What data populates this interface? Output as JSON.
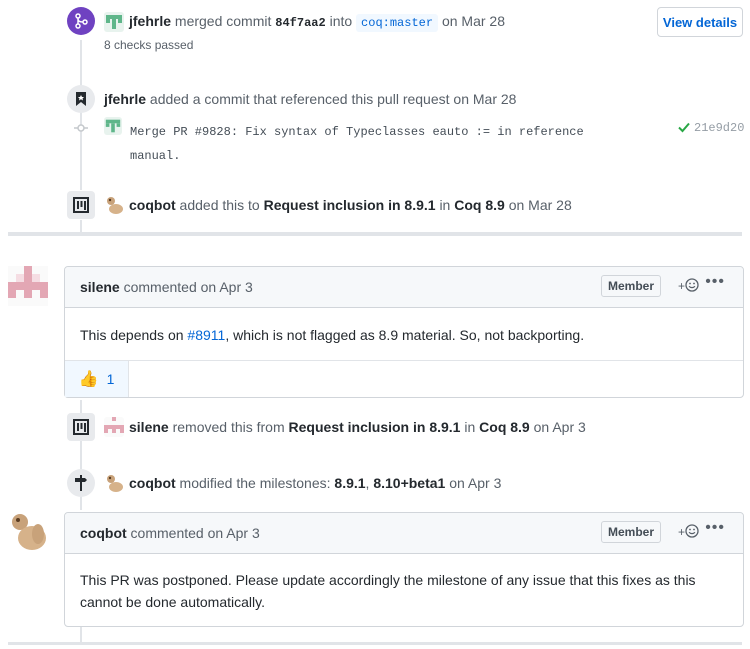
{
  "merge_event": {
    "user": "jfehrle",
    "action": "merged commit",
    "commit": "84f7aa2",
    "into": "into",
    "branch": "coq:master",
    "date": "on Mar 28",
    "checks": "8 checks passed",
    "view_details": "View details"
  },
  "reference_event": {
    "user": "jfehrle",
    "action": "added a commit that referenced this pull request on Mar 28",
    "commit_message_line1": "Merge PR #9828: Fix syntax of Typeclasses eauto := in reference",
    "commit_message_line2": "manual.",
    "commit_sha": "21e9d20"
  },
  "project_event_1": {
    "user": "coqbot",
    "action": "added this to",
    "column": "Request inclusion in 8.9.1",
    "in": "in",
    "project": "Coq 8.9",
    "date": "on Mar 28"
  },
  "comment_1": {
    "user": "silene",
    "meta": "commented on Apr 3",
    "role": "Member",
    "body_prefix": "This depends on",
    "issue_link": "#8911",
    "body_suffix": ", which is not flagged as 8.9 material. So, not backporting.",
    "reaction_emoji": "👍",
    "reaction_count": "1"
  },
  "project_event_2": {
    "user": "silene",
    "action": "removed this from",
    "column": "Request inclusion in 8.9.1",
    "in": "in",
    "project": "Coq 8.9",
    "date": "on Apr 3"
  },
  "milestone_event": {
    "user": "coqbot",
    "action": "modified the milestones:",
    "milestone_a": "8.9.1",
    "comma": ",",
    "milestone_b": "8.10+beta1",
    "date": "on Apr 3"
  },
  "comment_2": {
    "user": "coqbot",
    "meta": "commented on Apr 3",
    "role": "Member",
    "body_line1": "This PR was postponed. Please update accordingly the milestone of any issue that this fixes as this",
    "body_line2": "cannot be done automatically."
  },
  "colors": {
    "merged_purple": "#6f42c1",
    "link_blue": "#0366d6",
    "success_green": "#28a745",
    "timeline_gray": "#e1e4e8"
  },
  "icons": {
    "merge": "git-merge-icon",
    "bookmark": "bookmark-icon",
    "commit": "git-commit-icon",
    "project": "project-icon",
    "milestone": "milestone-icon",
    "check": "check-icon",
    "smiley": "smiley-icon",
    "kebab": "kebab-horizontal-icon"
  }
}
